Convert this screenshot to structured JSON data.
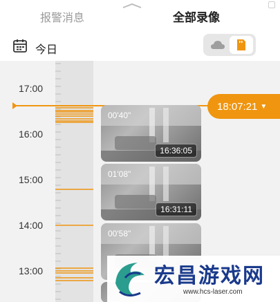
{
  "header": {
    "tab_alerts": "报警消息",
    "tab_all_recordings": "全部录像"
  },
  "date_row": {
    "date_label": "今日",
    "storage_options": [
      "cloud-icon",
      "sd-card-icon"
    ],
    "selected_storage": "sd-card-icon"
  },
  "timeline": {
    "hour_labels": [
      "17:00",
      "16:00",
      "15:00",
      "14:00",
      "13:00"
    ],
    "current_time": "18:07:21",
    "accent_color": "#f0950f"
  },
  "clips": [
    {
      "duration": "00'40\"",
      "start_time": "16:36:05"
    },
    {
      "duration": "01'08\"",
      "start_time": "16:31:11"
    },
    {
      "duration": "00'58\"",
      "start_time": ""
    }
  ],
  "watermark": {
    "title": "宏昌游戏网",
    "url": "www.hcs-laser.com"
  }
}
